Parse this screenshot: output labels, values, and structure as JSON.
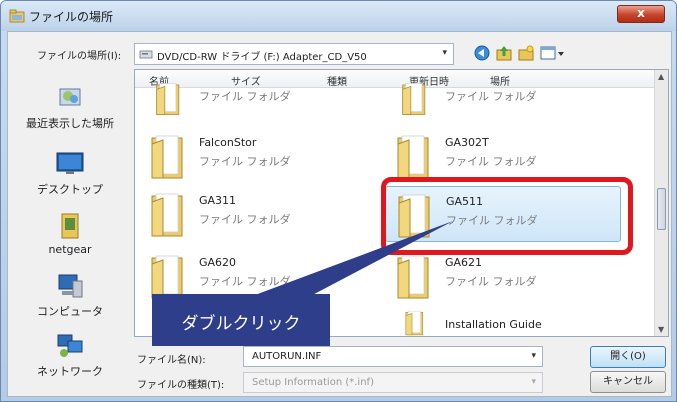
{
  "window": {
    "title": "ファイルの場所",
    "close_label": "x"
  },
  "lookin": {
    "label": "ファイルの場所(I):",
    "value": "DVD/CD-RW ドライブ (F:) Adapter_CD_V50",
    "arrow": "▾"
  },
  "toolbar": {
    "icons": [
      "back-globe-icon",
      "up-folder-icon",
      "new-folder-icon",
      "views-menu-icon"
    ]
  },
  "places": [
    {
      "label": "最近表示した場所",
      "icon": "recent-places-icon"
    },
    {
      "label": "デスクトップ",
      "icon": "desktop-icon"
    },
    {
      "label": "netgear",
      "icon": "user-folder-icon"
    },
    {
      "label": "コンピュータ",
      "icon": "computer-icon"
    },
    {
      "label": "ネットワーク",
      "icon": "network-icon"
    }
  ],
  "columns": [
    "名前",
    "サイズ",
    "種類",
    "更新日時",
    "場所"
  ],
  "files": [
    {
      "name": "",
      "type": "ファイル フォルダ"
    },
    {
      "name": "",
      "type": "ファイル フォルダ"
    },
    {
      "name": "FalconStor",
      "type": "ファイル フォルダ"
    },
    {
      "name": "GA302T",
      "type": "ファイル フォルダ"
    },
    {
      "name": "GA311",
      "type": "ファイル フォルダ"
    },
    {
      "name": "GA511",
      "type": "ファイル フォルダ",
      "selected": true
    },
    {
      "name": "GA620",
      "type": "ファイル フォルダ"
    },
    {
      "name": "GA621",
      "type": "ファイル フォルダ"
    },
    {
      "name": "",
      "type": ""
    },
    {
      "name": "Installation Guide",
      "type": ""
    }
  ],
  "annotation": {
    "callout_text": "ダブルクリック",
    "highlight_color": "#e0181e",
    "callout_color": "#2e3e8a"
  },
  "filename": {
    "label": "ファイル名(N):",
    "value": "AUTORUN.INF",
    "arrow": "▾"
  },
  "filetype": {
    "label": "ファイルの種類(T):",
    "value": "Setup Information (*.inf)",
    "arrow": "▾"
  },
  "buttons": {
    "open": "開く(O)",
    "cancel": "キャンセル"
  }
}
